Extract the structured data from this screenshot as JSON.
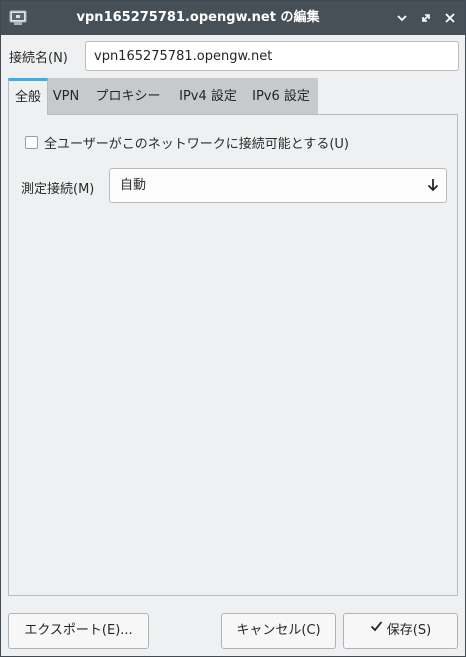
{
  "window": {
    "title": "vpn165275781.opengw.net の編集"
  },
  "connection_name": {
    "label": "接続名(N)",
    "value": "vpn165275781.opengw.net"
  },
  "tabs": [
    {
      "label": "全般",
      "active": true
    },
    {
      "label": "VPN",
      "active": false
    },
    {
      "label": "プロキシー",
      "active": false
    },
    {
      "label": "IPv4 設定",
      "active": false
    },
    {
      "label": "IPv6 設定",
      "active": false
    }
  ],
  "general": {
    "all_users_checkbox": {
      "label": "全ユーザーがこのネットワークに接続可能とする(U)",
      "checked": false
    },
    "metered": {
      "label": "測定接続(M)",
      "value": "自動"
    }
  },
  "buttons": {
    "export": "エクスポート(E)...",
    "cancel": "キャンセル(C)",
    "save": "保存(S)"
  },
  "colors": {
    "titlebar": "#475057",
    "accent": "#3daee9",
    "background": "#eff0f1"
  }
}
